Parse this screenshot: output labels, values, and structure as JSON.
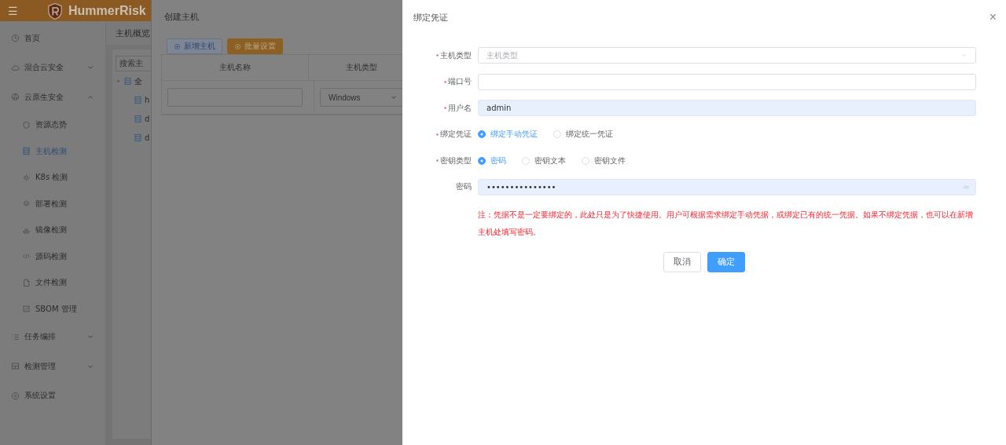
{
  "header": {
    "menu_icon": "☰",
    "logo": "HummerRisk"
  },
  "sidebar": {
    "items": [
      {
        "label": "首页",
        "selected": false
      },
      {
        "label": "混合云安全",
        "expanded": false,
        "selected": false
      },
      {
        "label": "云原生安全",
        "expanded": true,
        "selected": false,
        "children": [
          {
            "label": "资源态势",
            "selected": false
          },
          {
            "label": "主机检测",
            "selected": true
          },
          {
            "label": "K8s 检测",
            "selected": false
          },
          {
            "label": "部署检测",
            "selected": false
          },
          {
            "label": "镜像检测",
            "selected": false
          },
          {
            "label": "源码检测",
            "selected": false
          },
          {
            "label": "文件检测",
            "selected": false
          },
          {
            "label": "SBOM 管理",
            "selected": false
          }
        ]
      },
      {
        "label": "任务编排",
        "expanded": false,
        "selected": false
      },
      {
        "label": "检测管理",
        "expanded": false,
        "selected": false
      },
      {
        "label": "系统设置",
        "selected": false
      }
    ]
  },
  "content": {
    "tab": "主机概览",
    "search": {
      "placeholder": "搜索主"
    },
    "tree": {
      "label": "全",
      "expanded": true,
      "children": [
        {
          "label": "h"
        },
        {
          "label": "d"
        },
        {
          "label": "d"
        }
      ]
    }
  },
  "create_drawer": {
    "title": "创建主机",
    "buttons": [
      {
        "label": "新增主机",
        "kind": "plain"
      },
      {
        "label": "批量设置",
        "kind": "warning"
      }
    ],
    "table": {
      "columns": [
        "主机名称",
        "主机类型"
      ],
      "rows": [
        {
          "type": "Windows"
        }
      ]
    }
  },
  "bind_drawer": {
    "title": "绑定凭证",
    "close": "×",
    "fields": [
      {
        "kind": "select",
        "label": "主机类型",
        "required": true,
        "placeholder": "主机类型"
      },
      {
        "kind": "input",
        "label": "端口号",
        "required": true
      },
      {
        "kind": "input",
        "label": "用户名",
        "required": true,
        "value": "admin"
      },
      {
        "kind": "radio",
        "label": "绑定凭证",
        "required": true,
        "options": [
          {
            "label": "绑定手动凭证",
            "selected": true
          },
          {
            "label": "绑定统一凭证",
            "selected": false
          }
        ]
      },
      {
        "kind": "radio",
        "label": "密钥类型",
        "required": true,
        "options": [
          {
            "label": "密码",
            "selected": true
          },
          {
            "label": "密钥文本",
            "selected": false
          },
          {
            "label": "密钥文件",
            "selected": false
          }
        ]
      },
      {
        "kind": "password",
        "label": "密码",
        "required": false,
        "value": "•••••••••••••••"
      }
    ],
    "note": "注：凭据不是一定要绑定的，此处只是为了快捷使用。用户可根据需求绑定手动凭据，或绑定已有的统一凭据。如果不绑定凭据，也可以在新增主机处填写密码。",
    "buttons": [
      {
        "label": "取消",
        "kind": "plain"
      },
      {
        "label": "确定",
        "kind": "primary"
      }
    ]
  }
}
